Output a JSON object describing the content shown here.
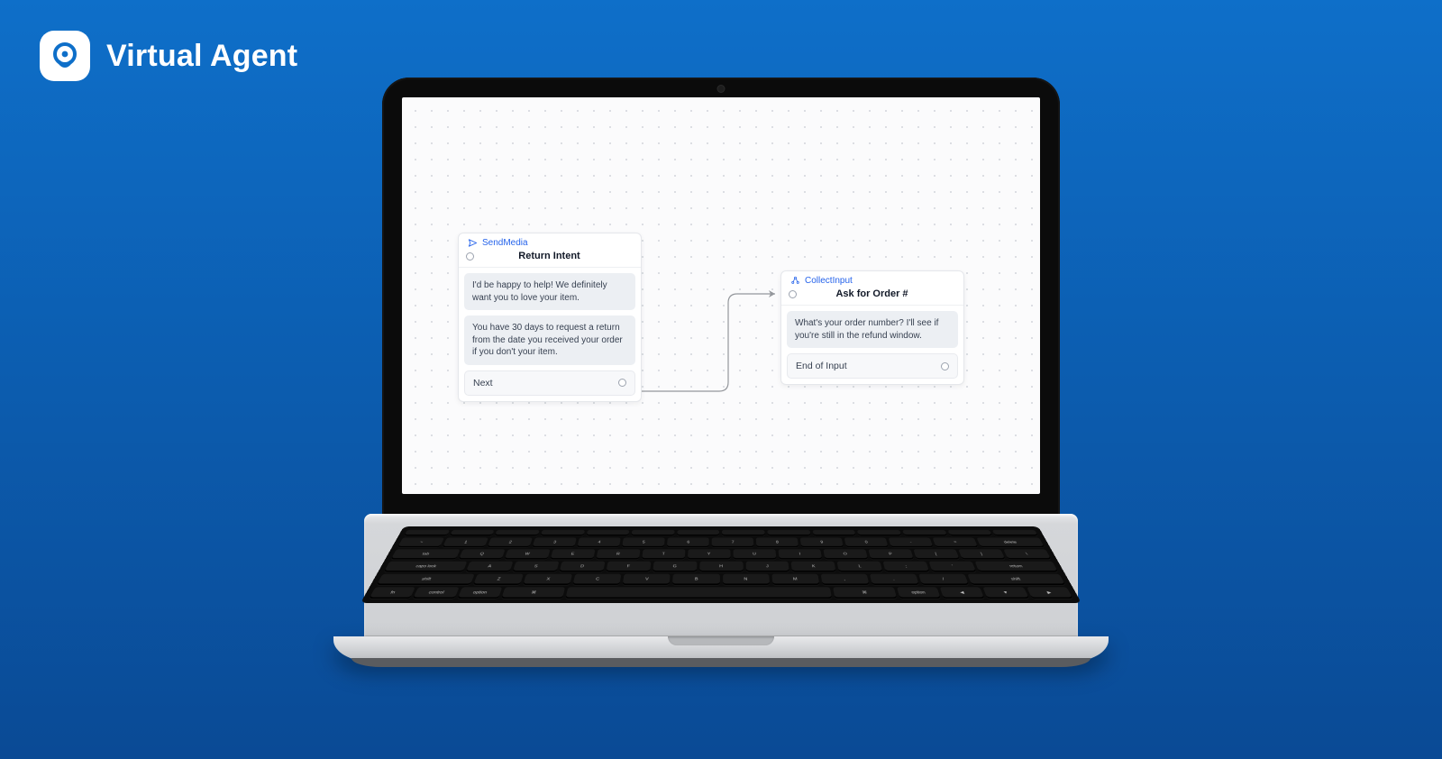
{
  "brand": {
    "title": "Virtual Agent"
  },
  "canvas": {
    "node_a": {
      "type": "SendMedia",
      "title": "Return Intent",
      "messages": [
        "I'd be happy to help! We definitely want you to love your item.",
        "You have 30 days to request a return from the date you received your order if you don't your item."
      ],
      "outlet": "Next"
    },
    "node_b": {
      "type": "CollectInput",
      "title": "Ask for Order #",
      "messages": [
        "What's your order number? I'll see if you're still in the refund window."
      ],
      "outlet": "End of Input"
    }
  }
}
